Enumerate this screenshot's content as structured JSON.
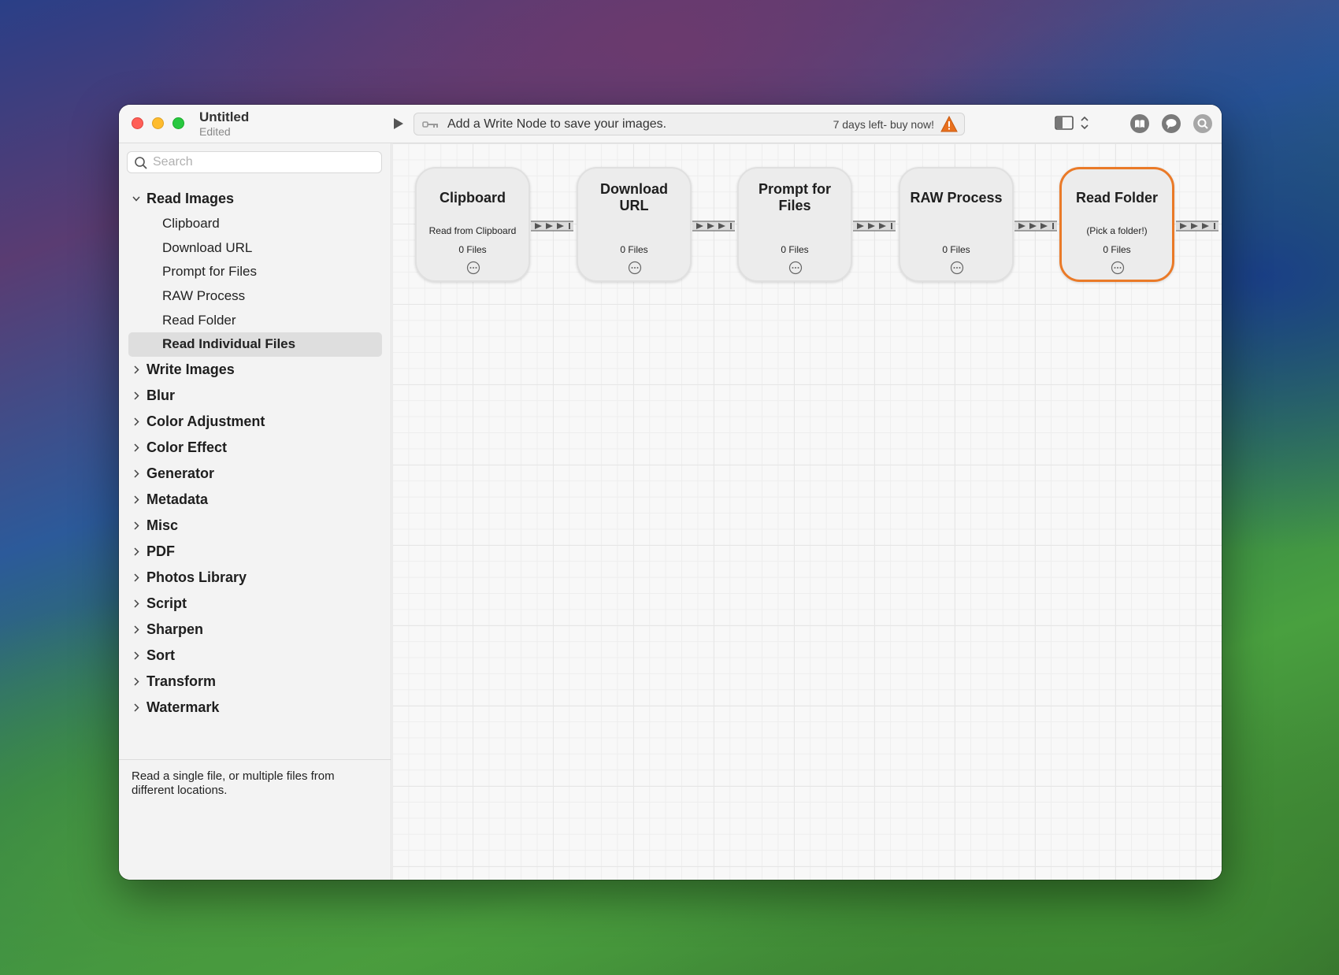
{
  "window": {
    "title": "Untitled",
    "subtitle": "Edited"
  },
  "toolbar": {
    "status_message": "Add a Write Node to save your images.",
    "trial_text": "7 days left- buy now!"
  },
  "search": {
    "placeholder": "Search",
    "value": ""
  },
  "sidebar": {
    "expanded_category": "Read Images",
    "read_items": [
      "Clipboard",
      "Download URL",
      "Prompt for Files",
      "RAW Process",
      "Read Folder",
      "Read Individual Files"
    ],
    "selected_item": "Read Individual Files",
    "categories": [
      "Write Images",
      "Blur",
      "Color Adjustment",
      "Color Effect",
      "Generator",
      "Metadata",
      "Misc",
      "PDF",
      "Photos Library",
      "Script",
      "Sharpen",
      "Sort",
      "Transform",
      "Watermark"
    ],
    "description": "Read a single file, or multiple files from different locations."
  },
  "nodes": [
    {
      "title": "Clipboard",
      "subtitle": "Read from Clipboard",
      "files": "0 Files"
    },
    {
      "title": "Download URL",
      "subtitle": "",
      "files": "0 Files"
    },
    {
      "title": "Prompt for Files",
      "subtitle": "",
      "files": "0 Files"
    },
    {
      "title": "RAW Process",
      "subtitle": "",
      "files": "0 Files"
    },
    {
      "title": "Read Folder",
      "subtitle": "(Pick a folder!)",
      "files": "0 Files"
    }
  ],
  "colors": {
    "active_node_border": "#ea7a28",
    "warning": "#e8701e"
  },
  "icons": {
    "run": "play-icon",
    "key": "key-icon",
    "warning": "warning-icon",
    "sidebar_toggle": "sidebar-toggle-icon",
    "book": "book-icon",
    "chat": "chat-bubble-icon",
    "find": "magnifier-icon",
    "more": "ellipsis-circle-icon"
  }
}
